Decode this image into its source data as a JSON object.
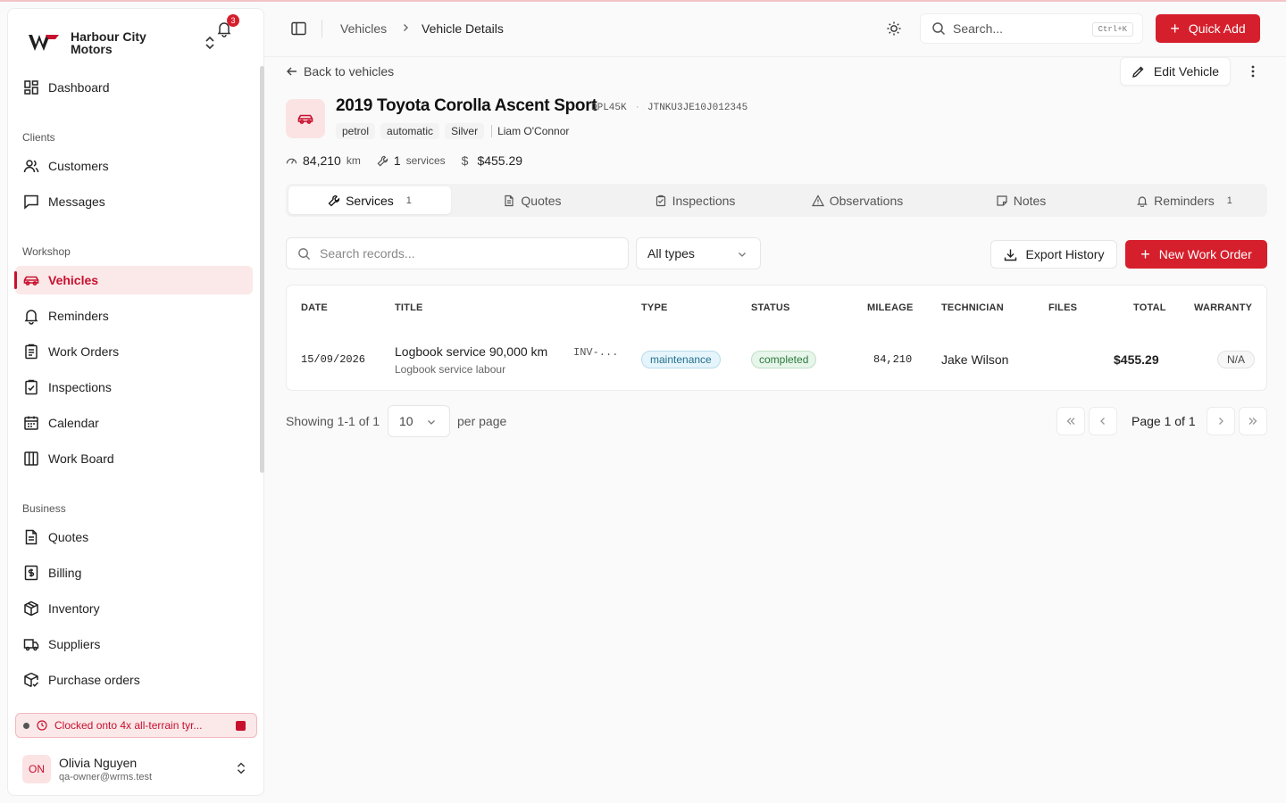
{
  "brand": {
    "name": "Harbour City Motors",
    "notification_count": "3"
  },
  "sidebar": {
    "dashboard": "Dashboard",
    "sections": {
      "clients": "Clients",
      "workshop": "Workshop",
      "business": "Business"
    },
    "clients": [
      "Customers",
      "Messages"
    ],
    "workshop": [
      "Vehicles",
      "Reminders",
      "Work Orders",
      "Inspections",
      "Calendar",
      "Work Board"
    ],
    "business": [
      "Quotes",
      "Billing",
      "Inventory",
      "Suppliers",
      "Purchase orders"
    ],
    "active": "Vehicles"
  },
  "clock_banner": "Clocked onto 4x all-terrain tyr...",
  "user": {
    "initials": "ON",
    "name": "Olivia Nguyen",
    "email": "qa-owner@wrms.test"
  },
  "header": {
    "breadcrumb": [
      "Vehicles",
      "Vehicle Details"
    ],
    "search_placeholder": "Search...",
    "search_shortcut": "Ctrl+K",
    "quick_add": "Quick Add"
  },
  "vehicle": {
    "back_label": "Back to vehicles",
    "edit_label": "Edit Vehicle",
    "title": "2019 Toyota Corolla Ascent Sport",
    "rego": "DPL45K",
    "separator": "·",
    "vin": "JTNKU3JE10J012345",
    "tags": [
      "petrol",
      "automatic",
      "Silver"
    ],
    "owner": "Liam O'Connor",
    "odometer": "84,210",
    "odometer_unit": "km",
    "services_count": "1",
    "services_label": "services",
    "total_currency": "$",
    "total_value": "$455.29"
  },
  "tabs": [
    {
      "label": "Services",
      "count": "1"
    },
    {
      "label": "Quotes",
      "count": ""
    },
    {
      "label": "Inspections",
      "count": ""
    },
    {
      "label": "Observations",
      "count": ""
    },
    {
      "label": "Notes",
      "count": ""
    },
    {
      "label": "Reminders",
      "count": "1"
    }
  ],
  "records": {
    "search_placeholder": "Search records...",
    "type_filter": "All types",
    "export_label": "Export History",
    "new_label": "New Work Order",
    "columns": [
      "DATE",
      "TITLE",
      "TYPE",
      "STATUS",
      "MILEAGE",
      "TECHNICIAN",
      "FILES",
      "TOTAL",
      "WARRANTY"
    ],
    "rows": [
      {
        "date": "15/09/2026",
        "title": "Logbook service 90,000 km",
        "invoice": "INV-...",
        "subtitle": "Logbook service labour",
        "type": "maintenance",
        "status": "completed",
        "mileage": "84,210",
        "technician": "Jake Wilson",
        "files": "",
        "total": "$455.29",
        "warranty": "N/A"
      }
    ]
  },
  "pagination": {
    "showing": "Showing 1-1 of 1",
    "per_page_value": "10",
    "per_page_label": "per page",
    "page_label": "Page 1 of 1"
  },
  "colors": {
    "accent": "#d61f2c",
    "active_bg": "#fbe8e9",
    "type_badge": "#e6f4fb",
    "status_badge": "#e7f5ea"
  }
}
